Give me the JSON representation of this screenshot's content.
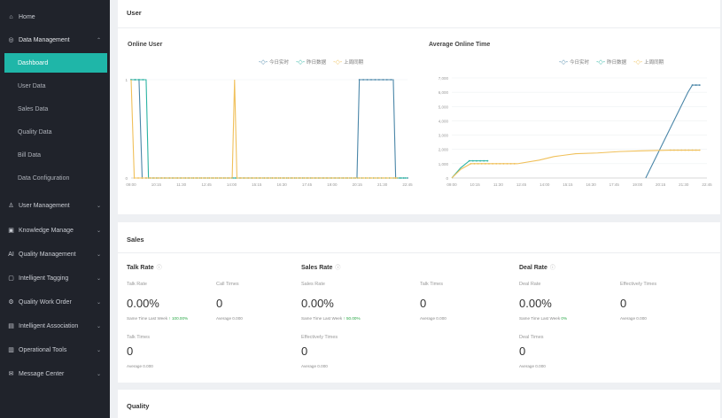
{
  "sidebar": {
    "items": [
      {
        "label": "Home",
        "icon": "home-icon",
        "glyph": "⌂",
        "type": "top",
        "chevron": false
      },
      {
        "label": "Data Management",
        "icon": "data-management-icon",
        "glyph": "◎",
        "type": "group",
        "chevron": "up"
      },
      {
        "label": "Dashboard",
        "type": "active"
      },
      {
        "label": "User Data",
        "type": "sub"
      },
      {
        "label": "Sales Data",
        "type": "sub"
      },
      {
        "label": "Quality Data",
        "type": "sub"
      },
      {
        "label": "Bill Data",
        "type": "sub"
      },
      {
        "label": "Data Configuration",
        "type": "sub"
      },
      {
        "label": "User Management",
        "icon": "user-icon",
        "glyph": "♙",
        "type": "top",
        "chevron": "down"
      },
      {
        "label": "Knowledge Manage",
        "icon": "knowledge-icon",
        "glyph": "▣",
        "type": "top",
        "chevron": "down"
      },
      {
        "label": "Quality Management",
        "icon": "quality-icon",
        "glyph": "AI",
        "type": "top",
        "chevron": "down"
      },
      {
        "label": "Intelligent Tagging",
        "icon": "tag-icon",
        "glyph": "▢",
        "type": "top",
        "chevron": "down"
      },
      {
        "label": "Quality Work Order",
        "icon": "work-order-icon",
        "glyph": "⚙",
        "type": "top",
        "chevron": "down"
      },
      {
        "label": "Intelligent Association",
        "icon": "association-icon",
        "glyph": "▤",
        "type": "top",
        "chevron": "down"
      },
      {
        "label": "Operational Tools",
        "icon": "tools-icon",
        "glyph": "▥",
        "type": "top",
        "chevron": "down"
      },
      {
        "label": "Message Center",
        "icon": "message-icon",
        "glyph": "✉",
        "type": "top",
        "chevron": "down"
      }
    ]
  },
  "user_panel": {
    "title": "User",
    "legend": [
      "今日实时",
      "昨日数据",
      "上周同期"
    ],
    "colors": {
      "today": "#4a86a8",
      "yesterday": "#2bb3a2",
      "last_week": "#f0c05a"
    }
  },
  "sales_panel": {
    "title": "Sales",
    "metrics": [
      {
        "title": "Talk Rate",
        "sub1_label": "Talk Rate",
        "sub2_label": "Call Times",
        "rate": "0.00%",
        "count": "0",
        "yoy_label": "Same Time Last Week",
        "yoy_value": "↑ 100.00%",
        "avg1": "Average 0.000",
        "third_label": "Talk Times",
        "third_value": "0",
        "avg2": "Average 0.000"
      },
      {
        "title": "Sales Rate",
        "sub1_label": "Sales Rate",
        "sub2_label": "Talk Times",
        "rate": "0.00%",
        "count": "0",
        "yoy_label": "Same Time Last Week",
        "yoy_value": "↑ 50.00%",
        "avg1": "Average 0.000",
        "third_label": "Effectively Times",
        "third_value": "0",
        "avg2": "Average 0.000"
      },
      {
        "title": "Deal Rate",
        "sub1_label": "Deal Rate",
        "sub2_label": "Effectively Times",
        "rate": "0.00%",
        "count": "0",
        "yoy_label": "Same Time Last Week",
        "yoy_value": "0%",
        "avg1": "Average 0.000",
        "third_label": "Deal Times",
        "third_value": "0",
        "avg2": "Average 0.000"
      }
    ]
  },
  "quality_panel": {
    "title": "Quality"
  },
  "chart_data": [
    {
      "type": "line",
      "title": "Online User",
      "x": [
        "09:00",
        "10:15",
        "11:30",
        "12:45",
        "14:00",
        "15:15",
        "16:30",
        "17:45",
        "19:00",
        "20:15",
        "21:30",
        "22:45"
      ],
      "ylim": [
        0,
        1
      ],
      "yticks": [
        "0",
        "1"
      ],
      "series": [
        {
          "name": "今日实时",
          "color": "#4a86a8",
          "points": [
            [
              0.0,
              1
            ],
            [
              1.0,
              1
            ],
            [
              1.4,
              0
            ],
            [
              28.6,
              0
            ],
            [
              28.9,
              1
            ],
            [
              33.2,
              1
            ],
            [
              33.5,
              0
            ],
            [
              35,
              0
            ]
          ]
        },
        {
          "name": "昨日数据",
          "color": "#2bb3a2",
          "points": [
            [
              0.0,
              1
            ],
            [
              1.9,
              1
            ],
            [
              2.2,
              0
            ],
            [
              35,
              0
            ]
          ]
        },
        {
          "name": "上周同期",
          "color": "#f0c05a",
          "points": [
            [
              0.0,
              1
            ],
            [
              0.4,
              0
            ],
            [
              12.8,
              0
            ],
            [
              13.1,
              1
            ],
            [
              13.4,
              0
            ],
            [
              33.5,
              0
            ],
            [
              33.8,
              0
            ]
          ]
        }
      ],
      "legend_position": "top-right"
    },
    {
      "type": "line",
      "title": "Average Online Time",
      "x": [
        "09:00",
        "10:15",
        "11:30",
        "12:45",
        "14:00",
        "15:15",
        "16:30",
        "17:45",
        "19:00",
        "20:15",
        "21:30",
        "22:45"
      ],
      "ylim": [
        0,
        7000
      ],
      "yticks": [
        "0",
        "1,000",
        "2,000",
        "3,000",
        "4,000",
        "5,000",
        "6,000",
        "7,000"
      ],
      "series": [
        {
          "name": "今日实时",
          "color": "#4a86a8",
          "points": [
            [
              26.6,
              0
            ],
            [
              32.4,
              6000
            ],
            [
              33.0,
              6500
            ],
            [
              34.0,
              6500
            ]
          ]
        },
        {
          "name": "昨日数据",
          "color": "#2bb3a2",
          "points": [
            [
              0,
              0
            ],
            [
              1.2,
              700
            ],
            [
              2.4,
              1200
            ],
            [
              5,
              1200
            ]
          ]
        },
        {
          "name": "上周同期",
          "color": "#f0c05a",
          "points": [
            [
              0,
              0
            ],
            [
              1.2,
              600
            ],
            [
              2.6,
              1000
            ],
            [
              9,
              1000
            ],
            [
              12,
              1250
            ],
            [
              14,
              1500
            ],
            [
              17,
              1700
            ],
            [
              20,
              1750
            ],
            [
              23,
              1850
            ],
            [
              26,
              1900
            ],
            [
              30,
              1950
            ],
            [
              34,
              1950
            ]
          ]
        }
      ],
      "legend_position": "top-right"
    }
  ]
}
